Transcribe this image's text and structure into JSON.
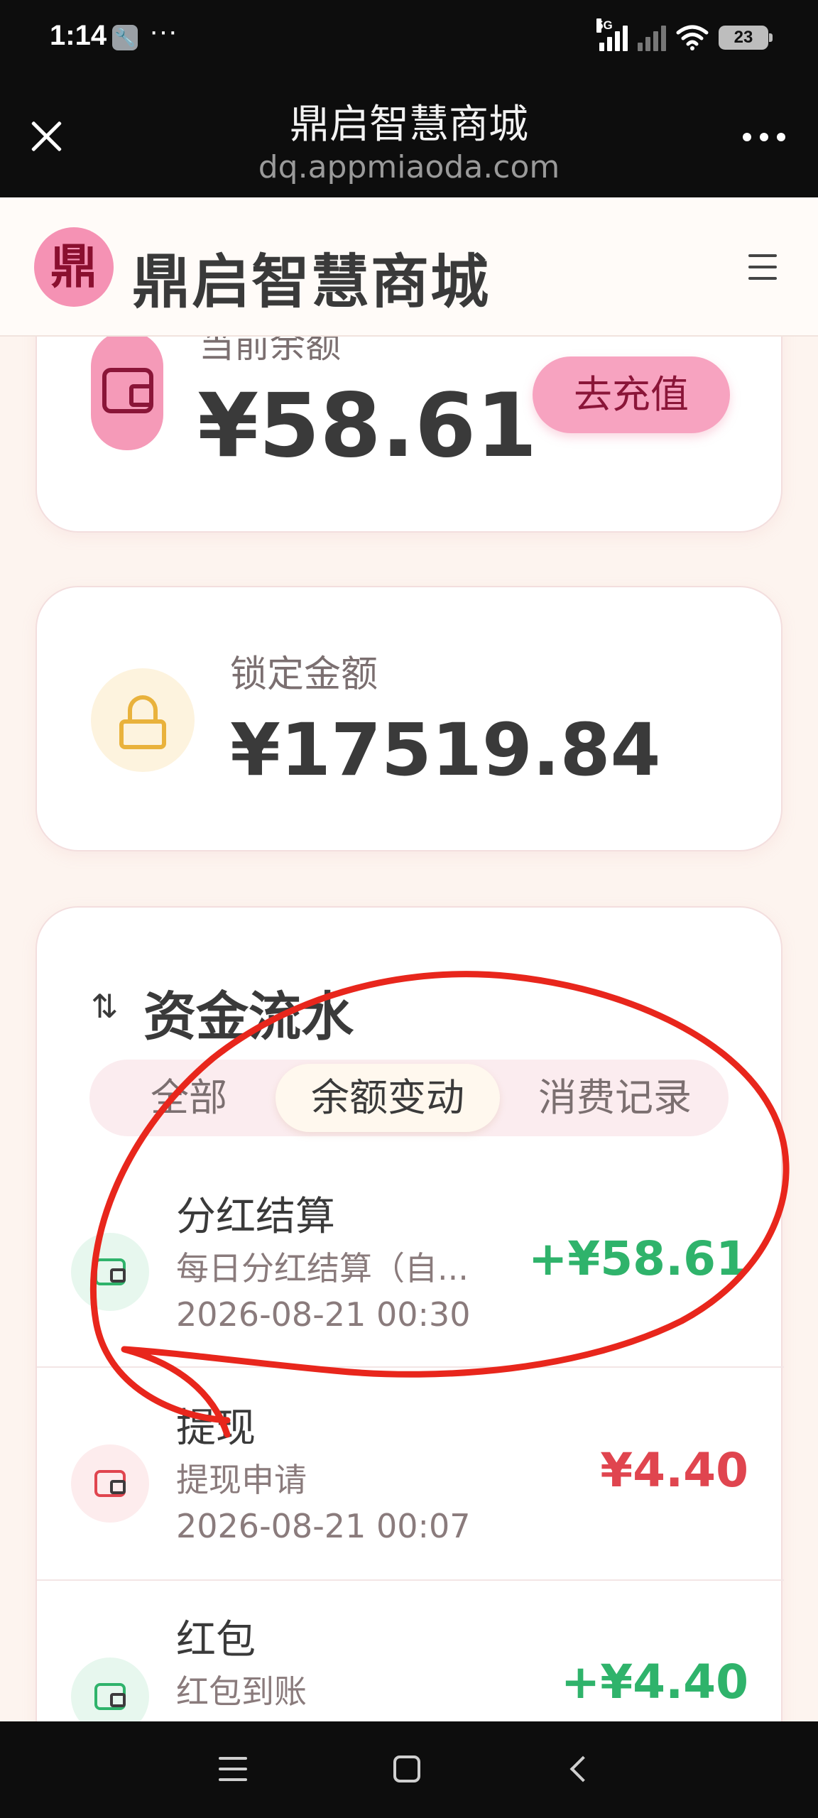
{
  "status_bar": {
    "time": "1:14",
    "dots": "···",
    "network_label": "5G",
    "battery": "23"
  },
  "browser": {
    "title": "鼎启智慧商城",
    "url": "dq.appmiaoda.com"
  },
  "header": {
    "logo_char": "鼎",
    "title": "鼎启智慧商城"
  },
  "balance": {
    "label": "当前余额",
    "amount": "¥58.61",
    "recharge_label": "去充值"
  },
  "locked": {
    "label": "锁定金额",
    "amount": "¥17519.84"
  },
  "flow": {
    "icon": "⇅",
    "title": "资金流水",
    "tabs": [
      {
        "label": "全部"
      },
      {
        "label": "余额变动"
      },
      {
        "label": "消费记录"
      }
    ],
    "active_tab": "余额变动",
    "records": [
      {
        "title": "分红结算",
        "desc": "每日分红结算（自...",
        "time": "2026-08-21 00:30",
        "amount": "+¥58.61",
        "type": "income"
      },
      {
        "title": "提现",
        "desc": "提现申请",
        "time": "2026-08-21 00:07",
        "amount": "¥4.40",
        "type": "expense"
      },
      {
        "title": "红包",
        "desc": "红包到账",
        "time": "",
        "amount": "+¥4.40",
        "type": "income"
      }
    ]
  },
  "colors": {
    "income": "#2fb36b",
    "expense": "#e0454f",
    "accent_pink": "#f7a3c0",
    "annotation_red": "#e8261c"
  },
  "icons": {
    "close": "close-icon",
    "more": "more-icon",
    "menu": "hamburger-menu-icon",
    "wallet": "wallet-icon",
    "lock": "lock-icon",
    "sort": "sort-arrows-icon"
  }
}
